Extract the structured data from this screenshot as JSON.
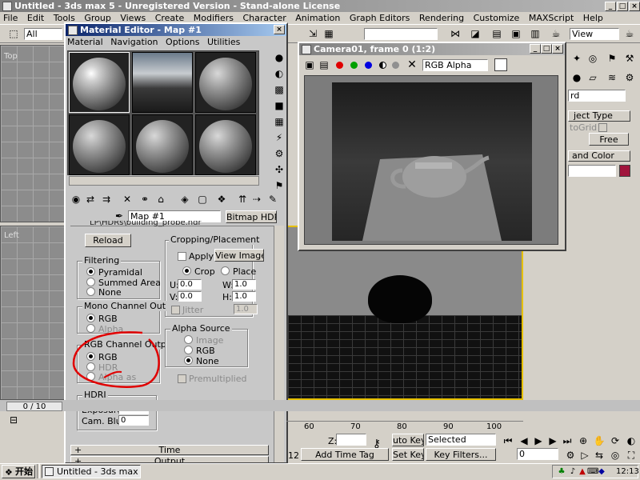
{
  "app": {
    "title": "Untitled - 3ds max 5 - Unregistered Version - Stand-alone License",
    "menu": [
      "File",
      "Edit",
      "Tools",
      "Group",
      "Views",
      "Create",
      "Modifiers",
      "Character",
      "Animation",
      "Graph Editors",
      "Rendering",
      "Customize",
      "MAXScript",
      "Help"
    ],
    "selection_filter": "All",
    "view_dropdown": "View",
    "viewport_labels": {
      "top": "Top",
      "left": "Left"
    }
  },
  "material_editor": {
    "title": "Material Editor - Map #1",
    "menu": [
      "Material",
      "Navigation",
      "Options",
      "Utilities"
    ],
    "map_name": "Map #1",
    "map_type": "Bitmap HDR",
    "path_text": "LP\\HDRs\\building_probe.hdr",
    "reload": "Reload",
    "cropping": {
      "title": "Cropping/Placement",
      "apply": "Apply",
      "view_image": "View Image",
      "crop": "Crop",
      "place": "Place",
      "u_label": "U:",
      "u_value": "0.0",
      "v_label": "V:",
      "v_value": "0.0",
      "w_label": "W:",
      "w_value": "1.0",
      "h_label": "H:",
      "h_value": "1.0",
      "jitter": "Jitter",
      "jitter_value": "1.0"
    },
    "filtering": {
      "title": "Filtering",
      "options": [
        "Pyramidal",
        "Summed Area",
        "None"
      ]
    },
    "mono": {
      "title": "Mono Channel Out",
      "options": [
        "RGB",
        "Alpha"
      ]
    },
    "rgb_out": {
      "title": "RGB Channel Outp",
      "options": [
        "RGB",
        "HDR",
        "Alpha as"
      ]
    },
    "alpha_source": {
      "title": "Alpha Source",
      "options": [
        "Image",
        "RGB",
        "None"
      ],
      "premultiplied": "Premultiplied"
    },
    "hdri": {
      "title": "HDRI",
      "exposure_label": "Exposure:",
      "exposure": "0",
      "cam_blur_label": "Cam. Blur:",
      "cam_blur": "0"
    },
    "rollouts": [
      "Time",
      "Output"
    ]
  },
  "render_window": {
    "title": "Camera01, frame 0 (1:2)",
    "channel": "RGB Alpha"
  },
  "command_panel": {
    "dropdown": "rd",
    "object_type_label": "ject Type",
    "autogrid": "toGrid",
    "free": "Free",
    "name_color": "and Color",
    "object_color": "#a0143c"
  },
  "timeline": {
    "frame_counter": "0 / 10",
    "ticks": [
      "60",
      "70",
      "80",
      "90",
      "100"
    ],
    "z_label": "Z:",
    "auto_key": "uto Key",
    "set_key": "Set Key",
    "selected": "Selected",
    "key_filters": "Key Filters...",
    "add_time_tag": "Add Time Tag",
    "frame_field": "0",
    "status_num": "12"
  },
  "taskbar": {
    "start": "开始",
    "task": "Untitled - 3ds max 5 - Un...",
    "clock": "12:13"
  }
}
